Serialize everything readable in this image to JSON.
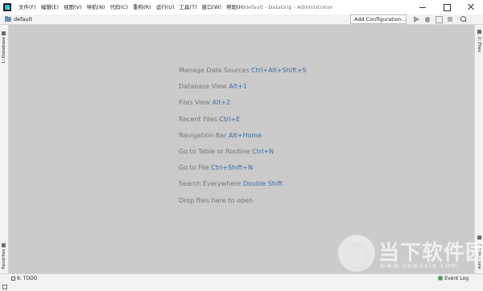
{
  "app": {
    "window_title": "default - DataGrip - Administrator",
    "icon": "datagrip-icon"
  },
  "menu": [
    {
      "label": "文件(F)"
    },
    {
      "label": "编辑(E)"
    },
    {
      "label": "视图(V)"
    },
    {
      "label": "导航(N)"
    },
    {
      "label": "代码(C)"
    },
    {
      "label": "重构(R)"
    },
    {
      "label": "运行(U)"
    },
    {
      "label": "工具(T)"
    },
    {
      "label": "窗口(W)"
    },
    {
      "label": "帮助(H)"
    }
  ],
  "navbar": {
    "breadcrumb": "default",
    "run_config": "Add Configuration..."
  },
  "toolbar_icons": [
    "run-icon",
    "debug-icon",
    "coverage-icon",
    "stop-icon",
    "search-icon"
  ],
  "left_stripe": {
    "top_tab": "1: Database",
    "bottom_tab": "Favorites"
  },
  "right_stripe": {
    "top_tab": "2: Files",
    "bottom_tab": "Z: Structure"
  },
  "editor_hints": [
    {
      "text": "Manage Data Sources ",
      "shortcut": "Ctrl+Alt+Shift+S"
    },
    {
      "text": "Database View ",
      "shortcut": "Alt+1"
    },
    {
      "text": "Files View ",
      "shortcut": "Alt+2"
    },
    {
      "text": "Recent Files ",
      "shortcut": "Ctrl+E"
    },
    {
      "text": "Navigation Bar ",
      "shortcut": "Alt+Home"
    },
    {
      "text": "Go to Table or Routine ",
      "shortcut": "Ctrl+N"
    },
    {
      "text": "Go to File ",
      "shortcut": "Ctrl+Shift+N"
    },
    {
      "text": "Search Everywhere ",
      "shortcut": "Double Shift"
    },
    {
      "text": "Drop files here to open",
      "shortcut": ""
    }
  ],
  "statusbar": {
    "todo": "6: TODO",
    "event_log": "Event Log"
  },
  "watermark": {
    "title": "当下软件园",
    "subtitle": "www.downxia.com"
  },
  "colors": {
    "editor_bg": "#cbcbcb",
    "shortcut": "#3d6fa8",
    "hint_text": "#777777"
  }
}
